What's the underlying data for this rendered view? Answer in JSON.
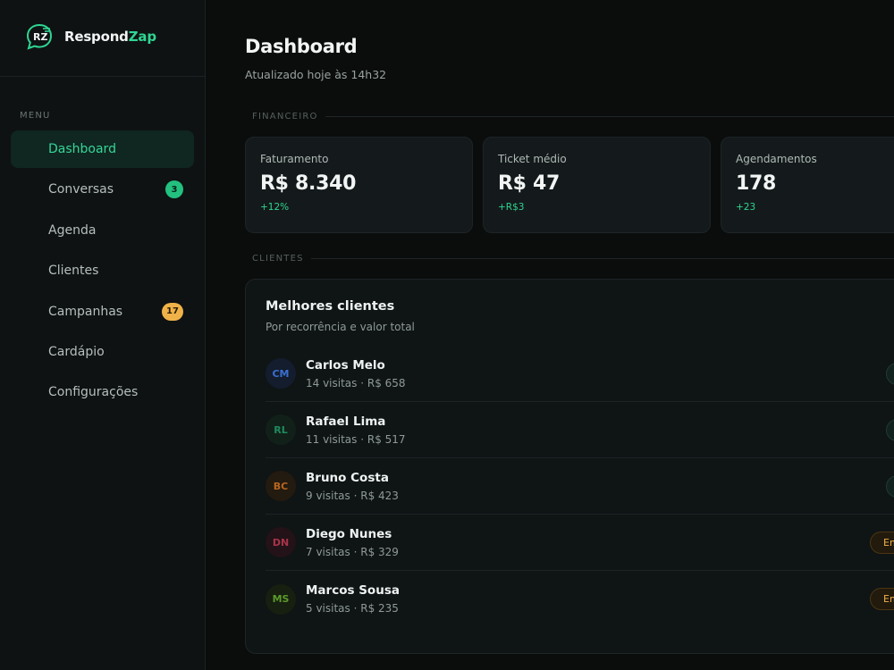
{
  "brand": {
    "name_part1": "Respond",
    "name_part2": "Zap",
    "logo_letters": "RZ",
    "accent": "#2fd592"
  },
  "sidebar": {
    "menu_label": "MENU",
    "items": [
      {
        "label": "Dashboard",
        "active": true,
        "badge": ""
      },
      {
        "label": "Conversas",
        "active": false,
        "badge": "3"
      },
      {
        "label": "Agenda",
        "active": false,
        "badge": ""
      },
      {
        "label": "Clientes",
        "active": false,
        "badge": ""
      },
      {
        "label": "Campanhas",
        "active": false,
        "badge": "17"
      },
      {
        "label": "Cardápio",
        "active": false,
        "badge": ""
      },
      {
        "label": "Configurações",
        "active": false,
        "badge": ""
      }
    ]
  },
  "header": {
    "title": "Dashboard",
    "subtitle": "Atualizado hoje às 14h32"
  },
  "financeiro": {
    "section_label": "FINANCEIRO",
    "stats": [
      {
        "label": "Faturamento",
        "value": "R$ 8.340",
        "delta": "+12%"
      },
      {
        "label": "Ticket médio",
        "value": "R$ 47",
        "delta": "+R$3"
      },
      {
        "label": "Agendamentos",
        "value": "178",
        "delta": "+23"
      }
    ]
  },
  "clientes": {
    "section_label": "CLIENTES",
    "card_title": "Melhores clientes",
    "card_subtitle": "Por recorrência e valor total",
    "rows": [
      {
        "initials": "CM",
        "name": "Carlos Melo",
        "meta": "14 visitas · R$ 658",
        "tag": "",
        "tag_style": "teal",
        "avatar_color": "#3b6fd1"
      },
      {
        "initials": "RL",
        "name": "Rafael Lima",
        "meta": "11 visitas · R$ 517",
        "tag": "",
        "tag_style": "teal",
        "avatar_color": "#1f8a5e"
      },
      {
        "initials": "BC",
        "name": "Bruno Costa",
        "meta": "9 visitas · R$ 423",
        "tag": "",
        "tag_style": "teal",
        "avatar_color": "#b8661f"
      },
      {
        "initials": "DN",
        "name": "Diego Nunes",
        "meta": "7 visitas · R$ 329",
        "tag": "Em",
        "tag_style": "amber",
        "avatar_color": "#a8344a"
      },
      {
        "initials": "MS",
        "name": "Marcos Sousa",
        "meta": "5 visitas · R$ 235",
        "tag": "Em",
        "tag_style": "amber",
        "avatar_color": "#5b9a2a"
      }
    ]
  }
}
